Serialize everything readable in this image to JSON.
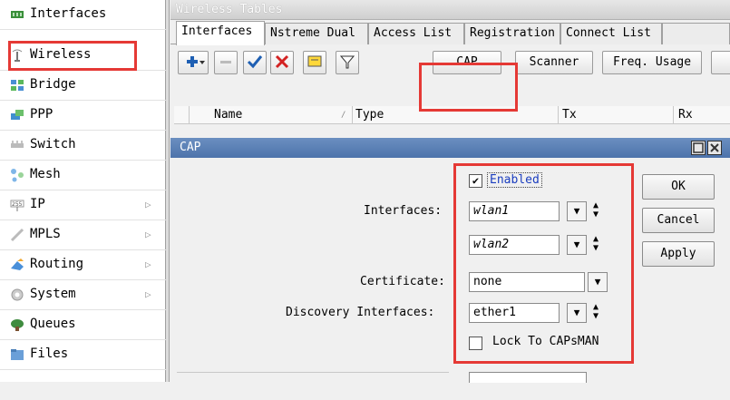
{
  "sidebar": {
    "items": [
      {
        "label": "Interfaces",
        "icon": "interfaces-icon",
        "submenu": false
      },
      {
        "label": "Wireless",
        "icon": "wireless-icon",
        "submenu": false
      },
      {
        "label": "Bridge",
        "icon": "bridge-icon",
        "submenu": false
      },
      {
        "label": "PPP",
        "icon": "ppp-icon",
        "submenu": false
      },
      {
        "label": "Switch",
        "icon": "switch-icon",
        "submenu": false
      },
      {
        "label": "Mesh",
        "icon": "mesh-icon",
        "submenu": false
      },
      {
        "label": "IP",
        "icon": "ip-icon",
        "submenu": true
      },
      {
        "label": "MPLS",
        "icon": "mpls-icon",
        "submenu": true
      },
      {
        "label": "Routing",
        "icon": "routing-icon",
        "submenu": true
      },
      {
        "label": "System",
        "icon": "system-icon",
        "submenu": true
      },
      {
        "label": "Queues",
        "icon": "queues-icon",
        "submenu": false
      },
      {
        "label": "Files",
        "icon": "files-icon",
        "submenu": false
      }
    ]
  },
  "window": {
    "title": "Wireless Tables"
  },
  "tabs": [
    "Interfaces",
    "Nstreme Dual",
    "Access List",
    "Registration",
    "Connect List"
  ],
  "toolbar": {
    "cap_label": "CAP",
    "scanner_label": "Scanner",
    "freq_usage_label": "Freq. Usage"
  },
  "columns": [
    "Name",
    "Type",
    "Tx",
    "Rx"
  ],
  "dialog": {
    "title": "CAP",
    "enabled_label": "Enabled",
    "enabled_checked": true,
    "interfaces_label": "Interfaces:",
    "interfaces": [
      "wlan1",
      "wlan2"
    ],
    "certificate_label": "Certificate:",
    "certificate_value": "none",
    "discovery_label": "Discovery Interfaces:",
    "discovery_value": "ether1",
    "lock_label": "Lock To CAPsMAN",
    "lock_checked": false,
    "ok_label": "OK",
    "cancel_label": "Cancel",
    "apply_label": "Apply"
  },
  "colors": {
    "highlight": "#e53935",
    "dialog_title": "#5a7fb6"
  }
}
